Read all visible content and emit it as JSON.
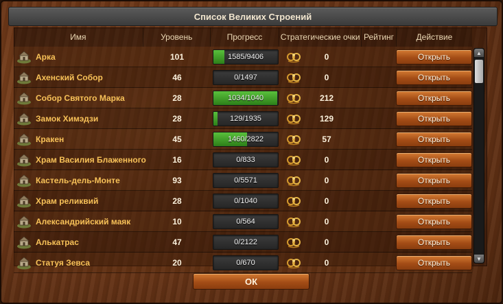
{
  "dialog": {
    "title": "Список Великих Строений",
    "ok_label": "ОК"
  },
  "columns": {
    "name": "Имя",
    "level": "Уровень",
    "progress": "Прогресс",
    "sp": "Стратегические очки",
    "rank": "Рейтинг",
    "action": "Действие"
  },
  "rows": [
    {
      "name": "Арка",
      "level": "101",
      "progress": "1585/9406",
      "progress_fraction": 0.1685,
      "sp": "0",
      "action": "Открыть",
      "icon": "arch-icon"
    },
    {
      "name": "Ахенский Собор",
      "level": "46",
      "progress": "0/1497",
      "progress_fraction": 0,
      "sp": "0",
      "action": "Открыть",
      "icon": "cathedral-icon"
    },
    {
      "name": "Собор Святого Марка",
      "level": "28",
      "progress": "1034/1040",
      "progress_fraction": 0.9942,
      "sp": "212",
      "action": "Открыть",
      "icon": "basilica-icon"
    },
    {
      "name": "Замок Химэдзи",
      "level": "28",
      "progress": "129/1935",
      "progress_fraction": 0.0667,
      "sp": "129",
      "action": "Открыть",
      "icon": "castle-icon"
    },
    {
      "name": "Кракен",
      "level": "45",
      "progress": "1460/2822",
      "progress_fraction": 0.5174,
      "sp": "57",
      "action": "Открыть",
      "icon": "kraken-icon"
    },
    {
      "name": "Храм Василия Блаженного",
      "level": "16",
      "progress": "0/833",
      "progress_fraction": 0,
      "sp": "0",
      "action": "Открыть",
      "icon": "church-icon"
    },
    {
      "name": "Кастель-дель-Монте",
      "level": "93",
      "progress": "0/5571",
      "progress_fraction": 0,
      "sp": "0",
      "action": "Открыть",
      "icon": "fortress-icon"
    },
    {
      "name": "Храм реликвий",
      "level": "28",
      "progress": "0/1040",
      "progress_fraction": 0,
      "sp": "0",
      "action": "Открыть",
      "icon": "temple-icon"
    },
    {
      "name": "Александрийский маяк",
      "level": "10",
      "progress": "0/564",
      "progress_fraction": 0,
      "sp": "0",
      "action": "Открыть",
      "icon": "lighthouse-icon"
    },
    {
      "name": "Алькатрас",
      "level": "47",
      "progress": "0/2122",
      "progress_fraction": 0,
      "sp": "0",
      "action": "Открыть",
      "icon": "prison-icon"
    },
    {
      "name": "Статуя Зевса",
      "level": "20",
      "progress": "0/670",
      "progress_fraction": 0,
      "sp": "0",
      "action": "Открыть",
      "icon": "statue-icon"
    }
  ],
  "colors": {
    "accent_name": "#f7c158",
    "progress_fill": "#3fa526",
    "button": "#b85c1f"
  }
}
